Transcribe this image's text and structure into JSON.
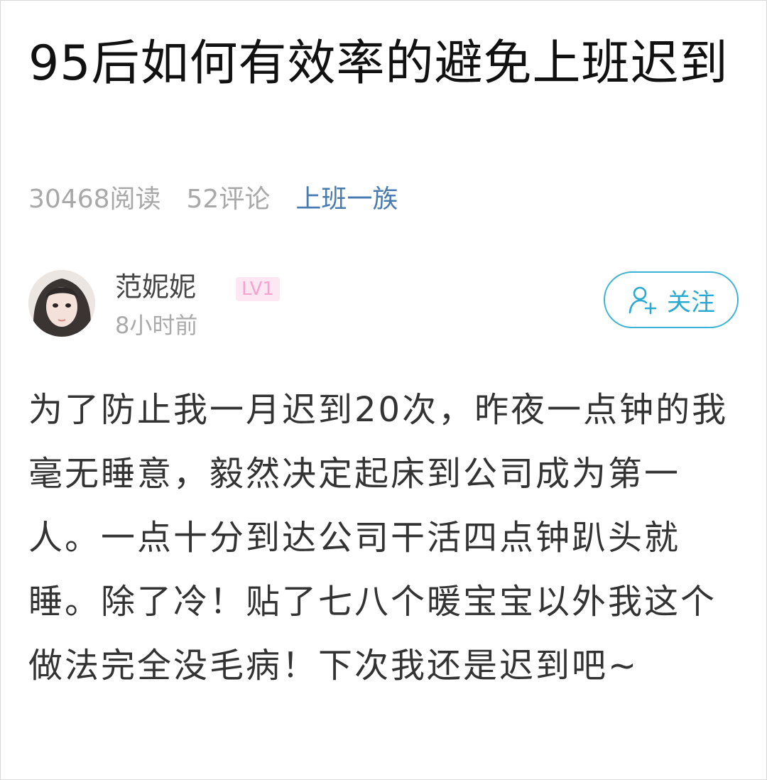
{
  "article": {
    "title": "95后如何有效率的避免上班迟到",
    "reads": "30468阅读",
    "comments": "52评论",
    "topic": "上班一族"
  },
  "author": {
    "name": "范妮妮",
    "level": "LV1",
    "time": "8小时前",
    "follow_label": "关注",
    "follow_icon": "add-user-icon"
  },
  "content": {
    "text": "为了防止我一月迟到20次，昨夜一点钟的我毫无睡意，毅然决定起床到公司成为第一人。一点十分到达公司干活四点钟趴头就睡。除了冷！贴了七八个暖宝宝以外我这个做法完全没毛病！下次我还是迟到吧~"
  },
  "colors": {
    "topic": "#4a7bb0",
    "follow_accent": "#2aaad2",
    "badge_bg": "#fde7f3",
    "badge_text": "#f5a3cf",
    "muted": "#a8a8a8"
  }
}
